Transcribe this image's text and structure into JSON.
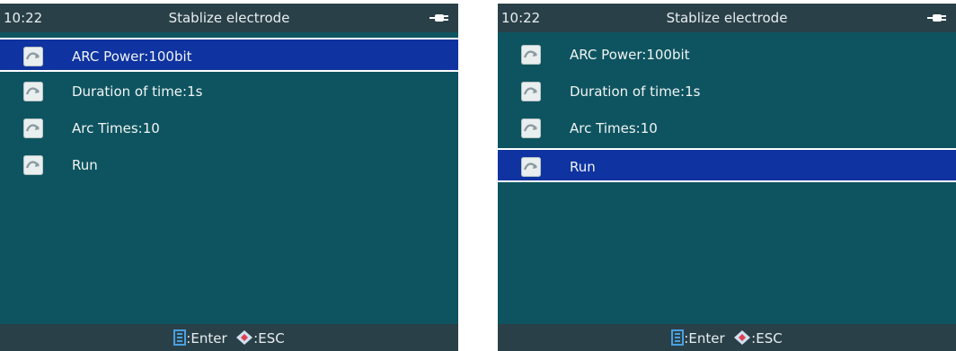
{
  "screens": [
    {
      "time": "10:22",
      "title": "Stablize electrode",
      "items": [
        {
          "label": "ARC Power:100bit",
          "selected": true
        },
        {
          "label": "Duration of time:1s",
          "selected": false
        },
        {
          "label": "Arc Times:10",
          "selected": false
        },
        {
          "label": "Run",
          "selected": false
        }
      ],
      "footer": {
        "enter_label": ":Enter",
        "esc_label": ":ESC"
      }
    },
    {
      "time": "10:22",
      "title": "Stablize electrode",
      "items": [
        {
          "label": "ARC Power:100bit",
          "selected": false
        },
        {
          "label": "Duration of time:1s",
          "selected": false
        },
        {
          "label": "Arc Times:10",
          "selected": false
        },
        {
          "label": "Run",
          "selected": true
        }
      ],
      "footer": {
        "enter_label": ":Enter",
        "esc_label": ":ESC"
      }
    }
  ],
  "icons": {
    "status": "plug-icon",
    "item": "arc-curve-icon",
    "enter": "enter-key-icon",
    "esc": "esc-diamond-icon"
  },
  "colors": {
    "screen_bg": "#0e5460",
    "bar_bg": "#2a4048",
    "selected_bg": "#0f33a0",
    "text": "#f0f4f4",
    "enter_icon": "#4aa0e0",
    "esc_icon_outer": "#d0e0f0",
    "esc_icon_inner": "#e04050"
  }
}
